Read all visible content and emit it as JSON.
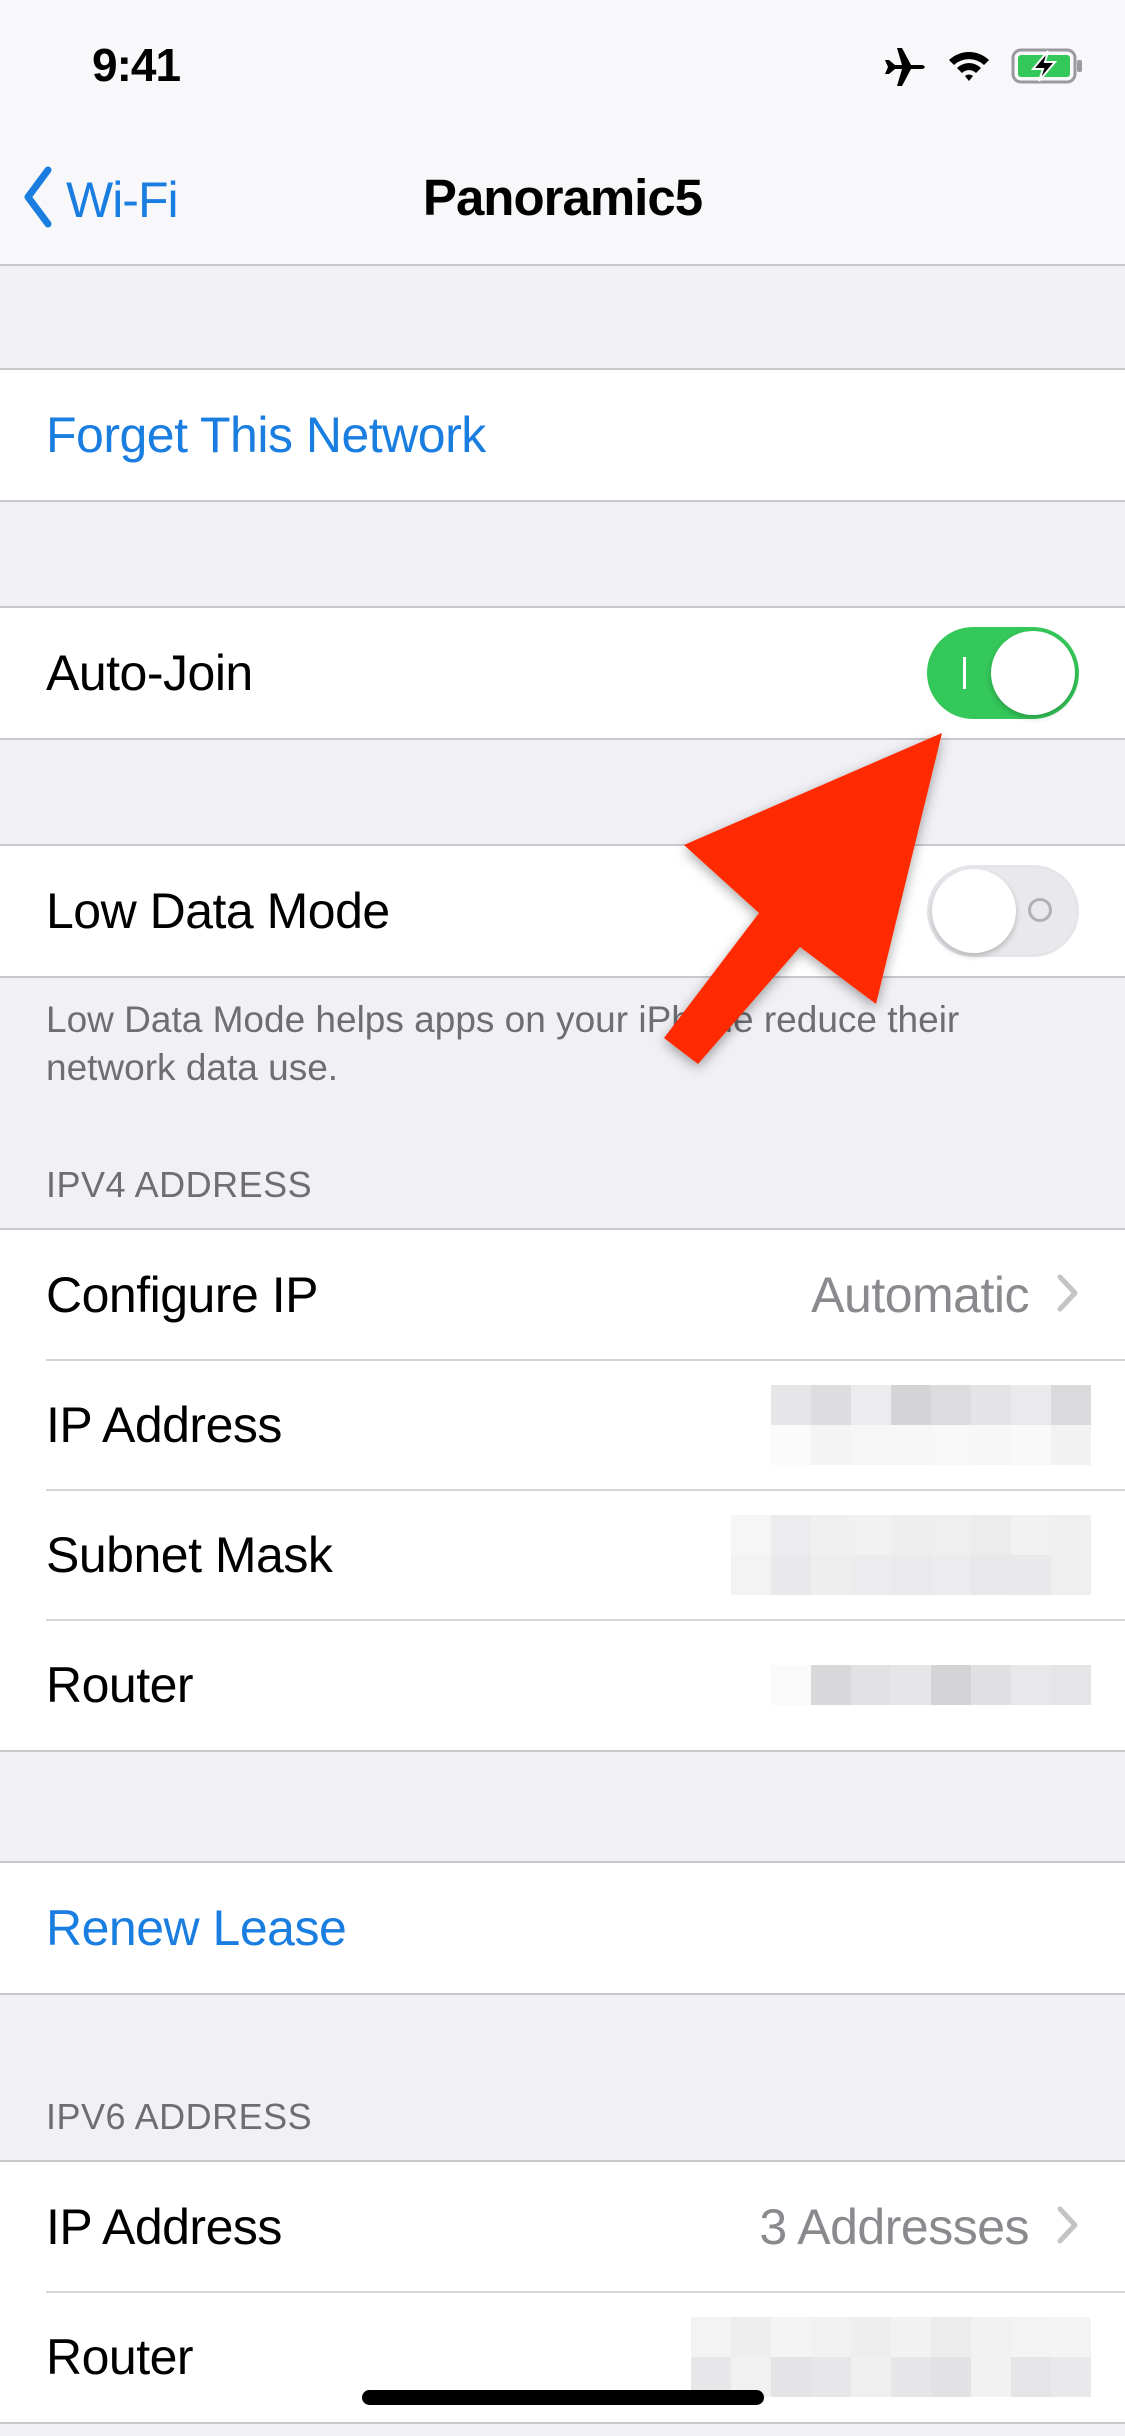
{
  "status_bar": {
    "time": "9:41",
    "icons": [
      "airplane-icon",
      "wifi-icon",
      "battery-charging-icon"
    ],
    "battery_color": "#34c759"
  },
  "nav": {
    "back_label": "Wi-Fi",
    "title": "Panoramic5",
    "accent_color": "#1a7ee0"
  },
  "actions": {
    "forget": "Forget This Network",
    "renew": "Renew Lease"
  },
  "toggles": {
    "auto_join": {
      "label": "Auto-Join",
      "on": true
    },
    "low_data_mode": {
      "label": "Low Data Mode",
      "on": false
    }
  },
  "low_data_footer": "Low Data Mode helps apps on your iPhone reduce their network data use.",
  "ipv4": {
    "header": "IPV4 ADDRESS",
    "rows": [
      {
        "label": "Configure IP",
        "value": "Automatic",
        "chevron": true
      },
      {
        "label": "IP Address",
        "value": "[redacted]",
        "chevron": false
      },
      {
        "label": "Subnet Mask",
        "value": "[redacted]",
        "chevron": false
      },
      {
        "label": "Router",
        "value": "[redacted]",
        "chevron": false
      }
    ]
  },
  "ipv6": {
    "header": "IPV6 ADDRESS",
    "rows": [
      {
        "label": "IP Address",
        "value": "3 Addresses",
        "chevron": true
      },
      {
        "label": "Router",
        "value": "[redacted]",
        "chevron": false
      }
    ]
  },
  "annotation": {
    "type": "red-arrow",
    "points_to": "Auto-Join toggle",
    "color": "#ff2a00"
  }
}
